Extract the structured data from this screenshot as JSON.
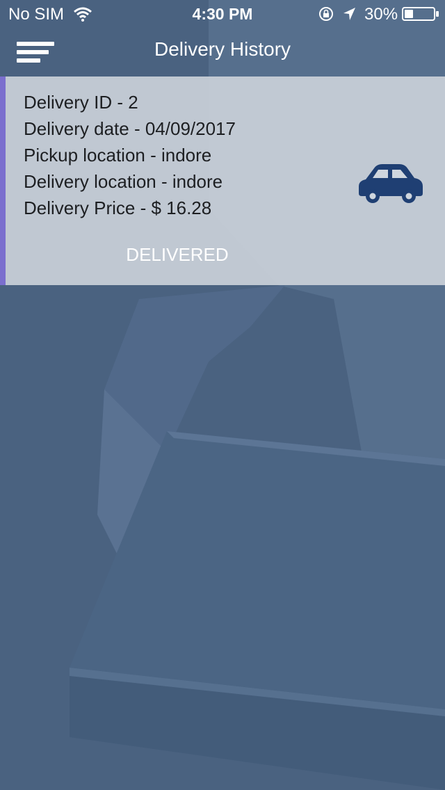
{
  "status_bar": {
    "carrier": "No SIM",
    "time": "4:30 PM",
    "battery_percent": "30%",
    "battery_level": 0.3,
    "icons": [
      "wifi-icon",
      "orientation-lock-icon",
      "location-arrow-icon",
      "battery-icon"
    ]
  },
  "nav": {
    "title": "Delivery History",
    "menu_icon": "hamburger-menu-icon"
  },
  "deliveries": [
    {
      "id_line": "Delivery ID - 2",
      "date_line": "Delivery date - 04/09/2017",
      "pickup_line": "Pickup location - indore",
      "dropoff_line": "Delivery location - indore",
      "price_line": "Delivery Price - $ 16.28",
      "status": "DELIVERED",
      "vehicle_icon": "car-icon"
    }
  ],
  "colors": {
    "background": "#4a6280",
    "card_overlay": "#d0d6dd",
    "accent_bar": "#7b6fce",
    "car_icon": "#1f3f73",
    "text_dark": "#1d1f22",
    "text_light": "#ffffff"
  }
}
